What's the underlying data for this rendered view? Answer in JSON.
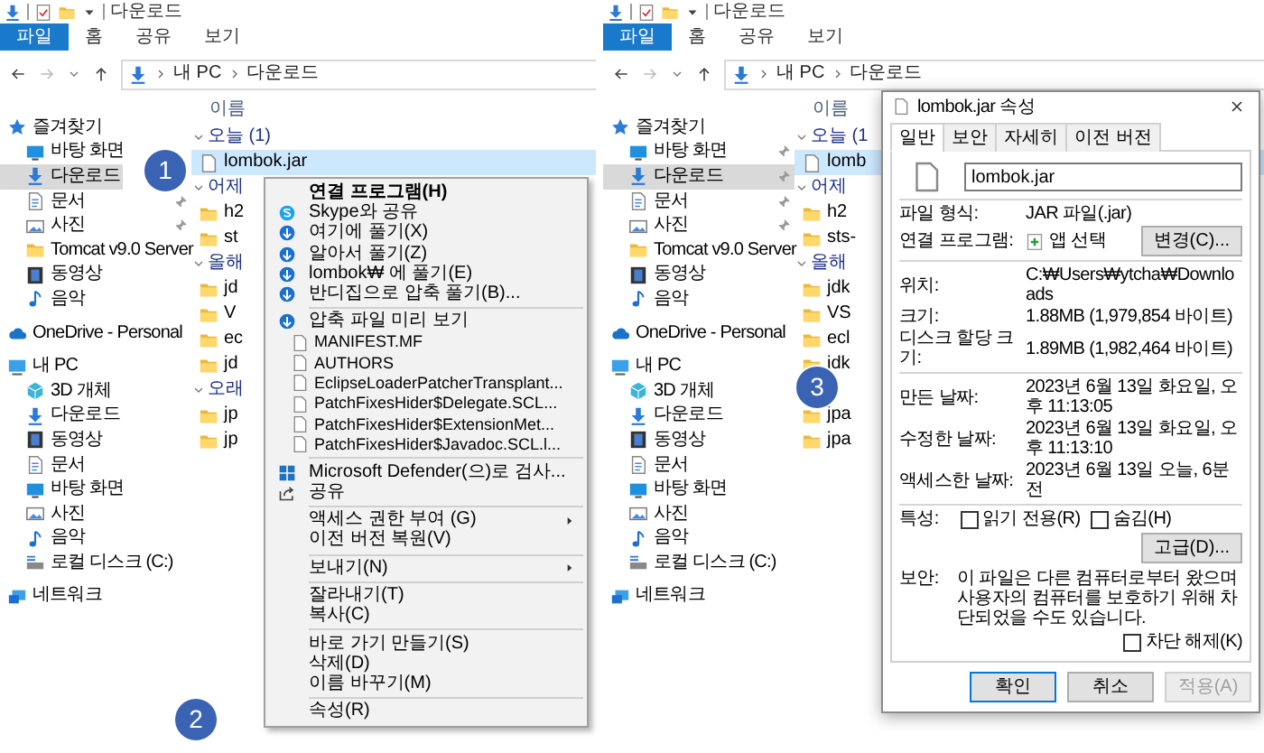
{
  "windows": [
    {
      "title": "다운로드",
      "ribbon_tabs": [
        {
          "label": "파일",
          "selected": true
        },
        {
          "label": "홈",
          "selected": false
        },
        {
          "label": "공유",
          "selected": false
        },
        {
          "label": "보기",
          "selected": false
        }
      ],
      "address": [
        "내 PC",
        "다운로드"
      ],
      "column_header": "이름",
      "sidebar": [
        {
          "label": "즐겨찾기",
          "kind": "star",
          "selected": false,
          "pinned": false,
          "children": [
            {
              "label": "바탕 화면",
              "kind": "desktop",
              "selected": false,
              "pinned": false
            },
            {
              "label": "다운로드",
              "kind": "download",
              "selected": true,
              "pinned": false
            },
            {
              "label": "문서",
              "kind": "document",
              "selected": false,
              "pinned": true
            },
            {
              "label": "사진",
              "kind": "picture",
              "selected": false,
              "pinned": true
            },
            {
              "label": "Tomcat v9.0 Server",
              "kind": "folder",
              "selected": false,
              "pinned": false
            },
            {
              "label": "동영상",
              "kind": "video",
              "selected": false,
              "pinned": false
            },
            {
              "label": "음악",
              "kind": "music",
              "selected": false,
              "pinned": false
            }
          ]
        },
        {
          "label": "OneDrive - Personal",
          "kind": "cloud",
          "selected": false,
          "pinned": false
        },
        {
          "label": "내 PC",
          "kind": "pc",
          "selected": false,
          "pinned": false,
          "children": [
            {
              "label": "3D 개체",
              "kind": "cube",
              "selected": false,
              "pinned": false
            },
            {
              "label": "다운로드",
              "kind": "download",
              "selected": false,
              "pinned": false
            },
            {
              "label": "동영상",
              "kind": "video",
              "selected": false,
              "pinned": false
            },
            {
              "label": "문서",
              "kind": "document",
              "selected": false,
              "pinned": false
            },
            {
              "label": "바탕 화면",
              "kind": "desktop",
              "selected": false,
              "pinned": false
            },
            {
              "label": "사진",
              "kind": "picture",
              "selected": false,
              "pinned": false
            },
            {
              "label": "음악",
              "kind": "music",
              "selected": false,
              "pinned": false
            },
            {
              "label": "로컬 디스크 (C:)",
              "kind": "disk",
              "selected": false,
              "pinned": false
            }
          ]
        },
        {
          "label": "네트워크",
          "kind": "network",
          "selected": false,
          "pinned": false
        }
      ],
      "file_groups": [
        {
          "label": "오늘 (1)",
          "items": [
            {
              "name": "lombok.jar",
              "kind": "file",
              "selected": true
            }
          ]
        },
        {
          "label": "어제",
          "items": [
            {
              "name": "h2",
              "kind": "folder",
              "selected": false
            },
            {
              "name": "st",
              "kind": "folder",
              "selected": false
            }
          ]
        },
        {
          "label": "올해",
          "items": [
            {
              "name": "jd",
              "kind": "folder",
              "selected": false
            },
            {
              "name": "V",
              "kind": "folder",
              "selected": false
            },
            {
              "name": "ec",
              "kind": "folder",
              "selected": false
            },
            {
              "name": "jd",
              "kind": "folder",
              "selected": false
            }
          ]
        },
        {
          "label": "오래",
          "items": [
            {
              "name": "jp",
              "kind": "folder",
              "selected": false
            },
            {
              "name": "jp",
              "kind": "folder",
              "selected": false
            }
          ]
        }
      ]
    },
    {
      "title": "다운로드",
      "ribbon_tabs": [
        {
          "label": "파일",
          "selected": true
        },
        {
          "label": "홈",
          "selected": false
        },
        {
          "label": "공유",
          "selected": false
        },
        {
          "label": "보기",
          "selected": false
        }
      ],
      "address": [
        "내 PC",
        "다운로드"
      ],
      "column_header": "이름",
      "sidebar": [
        {
          "label": "즐겨찾기",
          "kind": "star",
          "selected": false,
          "pinned": false,
          "children": [
            {
              "label": "바탕 화면",
              "kind": "desktop",
              "selected": false,
              "pinned": true
            },
            {
              "label": "다운로드",
              "kind": "download",
              "selected": true,
              "pinned": true
            },
            {
              "label": "문서",
              "kind": "document",
              "selected": false,
              "pinned": true
            },
            {
              "label": "사진",
              "kind": "picture",
              "selected": false,
              "pinned": true
            },
            {
              "label": "Tomcat v9.0 Server",
              "kind": "folder",
              "selected": false,
              "pinned": false
            },
            {
              "label": "동영상",
              "kind": "video",
              "selected": false,
              "pinned": false
            },
            {
              "label": "음악",
              "kind": "music",
              "selected": false,
              "pinned": false
            }
          ]
        },
        {
          "label": "OneDrive - Personal",
          "kind": "cloud",
          "selected": false,
          "pinned": false
        },
        {
          "label": "내 PC",
          "kind": "pc",
          "selected": false,
          "pinned": false,
          "children": [
            {
              "label": "3D 개체",
              "kind": "cube",
              "selected": false,
              "pinned": false
            },
            {
              "label": "다운로드",
              "kind": "download",
              "selected": false,
              "pinned": false
            },
            {
              "label": "동영상",
              "kind": "video",
              "selected": false,
              "pinned": false
            },
            {
              "label": "문서",
              "kind": "document",
              "selected": false,
              "pinned": false
            },
            {
              "label": "바탕 화면",
              "kind": "desktop",
              "selected": false,
              "pinned": false
            },
            {
              "label": "사진",
              "kind": "picture",
              "selected": false,
              "pinned": false
            },
            {
              "label": "음악",
              "kind": "music",
              "selected": false,
              "pinned": false
            },
            {
              "label": "로컬 디스크 (C:)",
              "kind": "disk",
              "selected": false,
              "pinned": false
            }
          ]
        },
        {
          "label": "네트워크",
          "kind": "network",
          "selected": false,
          "pinned": false
        }
      ],
      "file_groups": [
        {
          "label": "오늘 (1",
          "items": [
            {
              "name": "lomb",
              "kind": "file",
              "selected": true
            }
          ]
        },
        {
          "label": "어제",
          "items": [
            {
              "name": "h2",
              "kind": "folder",
              "selected": false
            },
            {
              "name": "sts-",
              "kind": "folder",
              "selected": false
            }
          ]
        },
        {
          "label": "올해",
          "items": [
            {
              "name": "jdk",
              "kind": "folder",
              "selected": false
            },
            {
              "name": "VS",
              "kind": "folder",
              "selected": false
            },
            {
              "name": "ecl",
              "kind": "folder",
              "selected": false
            },
            {
              "name": "jdk",
              "kind": "folder",
              "selected": false
            }
          ]
        },
        {
          "items": [
            {
              "name": "jpa",
              "kind": "folder",
              "selected": false
            },
            {
              "name": "jpa",
              "kind": "folder",
              "selected": false
            }
          ]
        }
      ]
    }
  ],
  "context_menu": {
    "items": [
      {
        "kind": "plain",
        "label": "연결 프로그램(H)",
        "bold": true,
        "submenu": false
      },
      {
        "kind": "skype",
        "label": "Skype와 공유",
        "bold": false,
        "submenu": false
      },
      {
        "kind": "bandizip",
        "label": "여기에 풀기(X)",
        "bold": false,
        "submenu": false
      },
      {
        "kind": "bandizip",
        "label": "알아서 풀기(Z)",
        "bold": false,
        "submenu": false
      },
      {
        "kind": "bandizip",
        "label": "lombok₩ 에 풀기(E)",
        "bold": false,
        "submenu": false
      },
      {
        "kind": "bandizip",
        "label": "반디집으로 압축 풀기(B)...",
        "bold": false,
        "submenu": false
      },
      {
        "kind": "separator"
      },
      {
        "kind": "bandizip",
        "label": "압축 파일 미리 보기",
        "bold": false,
        "submenu": false
      },
      {
        "kind": "file",
        "label": "MANIFEST.MF",
        "bold": false,
        "submenu": false
      },
      {
        "kind": "file",
        "label": "AUTHORS",
        "bold": false,
        "submenu": false
      },
      {
        "kind": "file",
        "label": "EclipseLoaderPatcherTransplant...",
        "bold": false,
        "submenu": false
      },
      {
        "kind": "file",
        "label": "PatchFixesHider$Delegate.SCL...",
        "bold": false,
        "submenu": false
      },
      {
        "kind": "file",
        "label": "PatchFixesHider$ExtensionMet...",
        "bold": false,
        "submenu": false
      },
      {
        "kind": "file",
        "label": "PatchFixesHider$Javadoc.SCL.l...",
        "bold": false,
        "submenu": false
      },
      {
        "kind": "separator"
      },
      {
        "kind": "defender",
        "label": "Microsoft Defender(으)로 검사...",
        "bold": false,
        "submenu": false
      },
      {
        "kind": "share",
        "label": "공유",
        "bold": false,
        "submenu": false
      },
      {
        "kind": "separator"
      },
      {
        "kind": "plain",
        "label": "액세스 권한 부여 (G)",
        "bold": false,
        "submenu": true
      },
      {
        "kind": "plain",
        "label": "이전 버전 복원(V)",
        "bold": false,
        "submenu": false
      },
      {
        "kind": "separator"
      },
      {
        "kind": "plain",
        "label": "보내기(N)",
        "bold": false,
        "submenu": true
      },
      {
        "kind": "separator"
      },
      {
        "kind": "plain",
        "label": "잘라내기(T)",
        "bold": false,
        "submenu": false
      },
      {
        "kind": "plain",
        "label": "복사(C)",
        "bold": false,
        "submenu": false
      },
      {
        "kind": "separator"
      },
      {
        "kind": "plain",
        "label": "바로 가기 만들기(S)",
        "bold": false,
        "submenu": false
      },
      {
        "kind": "plain",
        "label": "삭제(D)",
        "bold": false,
        "submenu": false
      },
      {
        "kind": "plain",
        "label": "이름 바꾸기(M)",
        "bold": false,
        "submenu": false
      },
      {
        "kind": "separator"
      },
      {
        "kind": "plain",
        "label": "속성(R)",
        "bold": false,
        "submenu": false
      }
    ]
  },
  "properties_dialog": {
    "title": "lombok.jar 속성",
    "tabs": [
      {
        "label": "일반",
        "selected": true
      },
      {
        "label": "보안",
        "selected": false
      },
      {
        "label": "자세히",
        "selected": false
      },
      {
        "label": "이전 버전",
        "selected": false
      }
    ],
    "file_name": "lombok.jar",
    "sections": [
      [
        {
          "label": "파일 형식:",
          "value": "JAR 파일(.jar)"
        },
        {
          "label": "연결 프로그램:",
          "value": "앱 선택",
          "button": "변경(C)..."
        }
      ],
      [
        {
          "label": "위치:",
          "value": "C:₩Users₩ytcha₩Downloads"
        },
        {
          "label": "크기:",
          "value": "1.88MB (1,979,854 바이트)"
        },
        {
          "label": "디스크 할당 크기:",
          "value": "1.89MB (1,982,464 바이트)"
        }
      ],
      [
        {
          "label": "만든 날짜:",
          "value": "2023년 6월 13일 화요일, 오후 11:13:05"
        },
        {
          "label": "수정한 날짜:",
          "value": "2023년 6월 13일 화요일, 오후 11:13:10"
        },
        {
          "label": "액세스한 날짜:",
          "value": "2023년 6월 13일 오늘, 6분 전"
        }
      ]
    ],
    "attributes": {
      "label": "특성:",
      "checkboxes": [
        {
          "label": "읽기 전용(R)",
          "checked": false
        },
        {
          "label": "숨김(H)",
          "checked": false
        }
      ],
      "button": "고급(D)..."
    },
    "security": {
      "label": "보안:",
      "text": "이 파일은 다른 컴퓨터로부터 왔으며 사용자의 컴퓨터를 보호하기 위해 차단되었을 수도 있습니다.",
      "checkbox": {
        "label": "차단 해제(K)",
        "checked": false
      }
    },
    "buttons": [
      {
        "label": "확인",
        "default": true,
        "disabled": false
      },
      {
        "label": "취소",
        "default": false,
        "disabled": false
      },
      {
        "label": "적용(A)",
        "default": false,
        "disabled": true
      }
    ]
  },
  "step_badges": [
    {
      "label": "1"
    },
    {
      "label": "2"
    },
    {
      "label": "3"
    }
  ]
}
